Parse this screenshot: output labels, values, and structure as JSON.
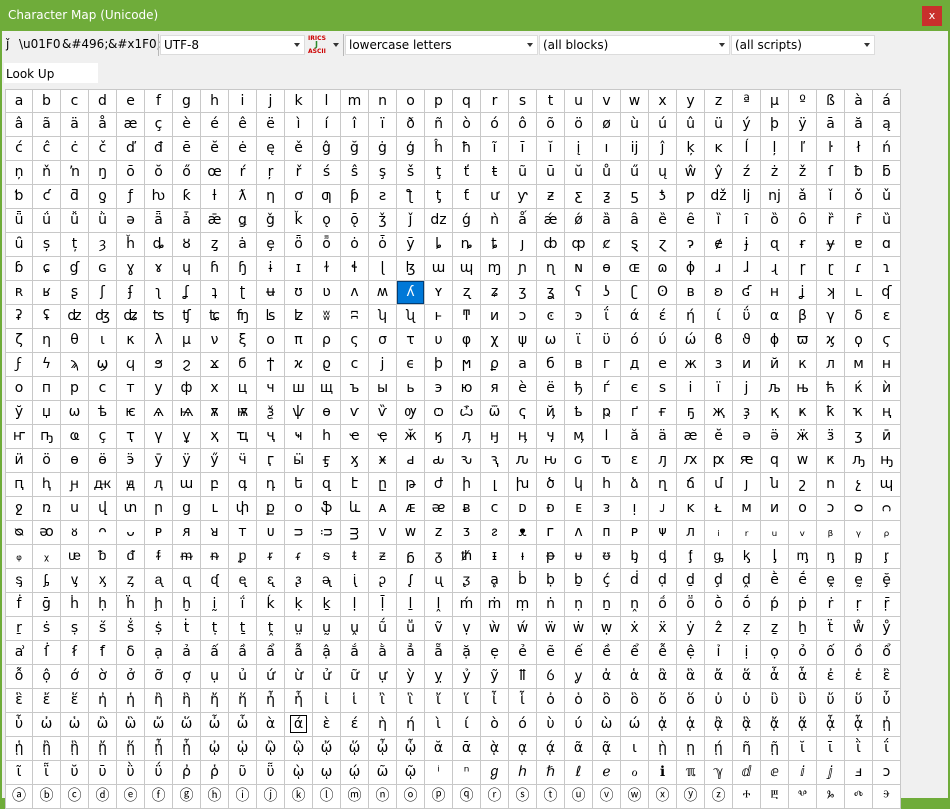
{
  "window": {
    "title": "Character Map (Unicode)",
    "close_label": "x"
  },
  "toolbar": {
    "char_glyph": "ǰ",
    "escape_u": "\\u01F0",
    "entity_dec": "&#496;",
    "entity_hex": "&#x1F0;",
    "encoding": "UTF-8",
    "ascii_top": "IRICS",
    "ascii_mid": "J",
    "ascii_bot": "ASCII",
    "category": "lowercase letters",
    "blocks": "(all blocks)",
    "scripts": "(all scripts)"
  },
  "lookup": {
    "label": "Look Up",
    "value": ""
  },
  "colors": {
    "title_bar": "#6fac3a",
    "selection": "#0078d7",
    "close": "#c9302c"
  },
  "grid": {
    "columns": 32,
    "selected": [
      8,
      14
    ],
    "boxed": [
      26,
      10
    ],
    "rows": [
      [
        "a",
        "b",
        "c",
        "d",
        "e",
        "f",
        "g",
        "h",
        "i",
        "j",
        "k",
        "l",
        "m",
        "n",
        "o",
        "p",
        "q",
        "r",
        "s",
        "t",
        "u",
        "v",
        "w",
        "x",
        "y",
        "z",
        "ª",
        "µ",
        "º",
        "ß",
        "à",
        "á"
      ],
      [
        "â",
        "ã",
        "ä",
        "å",
        "æ",
        "ç",
        "è",
        "é",
        "ê",
        "ë",
        "ì",
        "í",
        "î",
        "ï",
        "ð",
        "ñ",
        "ò",
        "ó",
        "ô",
        "õ",
        "ö",
        "ø",
        "ù",
        "ú",
        "û",
        "ü",
        "ý",
        "þ",
        "ÿ",
        "ā",
        "ă",
        "ą"
      ],
      [
        "ć",
        "ĉ",
        "ċ",
        "č",
        "ď",
        "đ",
        "ē",
        "ĕ",
        "ė",
        "ę",
        "ě",
        "ĝ",
        "ğ",
        "ġ",
        "ģ",
        "ĥ",
        "ħ",
        "ĩ",
        "ī",
        "ĭ",
        "į",
        "ı",
        "ĳ",
        "ĵ",
        "ķ",
        "ĸ",
        "ĺ",
        "ļ",
        "ľ",
        "ŀ",
        "ł",
        "ń"
      ],
      [
        "ņ",
        "ň",
        "ŉ",
        "ŋ",
        "ō",
        "ŏ",
        "ő",
        "œ",
        "ŕ",
        "ŗ",
        "ř",
        "ś",
        "ŝ",
        "ş",
        "š",
        "ţ",
        "ť",
        "ŧ",
        "ũ",
        "ū",
        "ŭ",
        "ů",
        "ű",
        "ų",
        "ŵ",
        "ŷ",
        "ź",
        "ż",
        "ž",
        "ſ",
        "ƀ",
        "ƃ"
      ],
      [
        "ƅ",
        "ƈ",
        "ƌ",
        "ƍ",
        "ƒ",
        "ƕ",
        "ƙ",
        "ƚ",
        "ƛ",
        "ƞ",
        "ơ",
        "ƣ",
        "ƥ",
        "ƨ",
        "ƪ",
        "ƫ",
        "ƭ",
        "ư",
        "ƴ",
        "ƶ",
        "ƹ",
        "ƺ",
        "ƽ",
        "ƾ",
        "ƿ",
        "dž",
        "lj",
        "nj",
        "ǎ",
        "ǐ",
        "ǒ",
        "ǔ"
      ],
      [
        "ǖ",
        "ǘ",
        "ǚ",
        "ǜ",
        "ǝ",
        "ǟ",
        "ǡ",
        "ǣ",
        "ǥ",
        "ǧ",
        "ǩ",
        "ǫ",
        "ǭ",
        "ǯ",
        "ǰ",
        "dz",
        "ǵ",
        "ǹ",
        "ǻ",
        "ǽ",
        "ǿ",
        "ȁ",
        "ȃ",
        "ȅ",
        "ȇ",
        "ȉ",
        "ȋ",
        "ȍ",
        "ȏ",
        "ȑ",
        "ȓ",
        "ȕ"
      ],
      [
        "ȗ",
        "ș",
        "ț",
        "ȝ",
        "ȟ",
        "ȡ",
        "ȣ",
        "ȥ",
        "ȧ",
        "ȩ",
        "ȫ",
        "ȭ",
        "ȯ",
        "ȱ",
        "ȳ",
        "ȴ",
        "ȵ",
        "ȶ",
        "ȷ",
        "ȸ",
        "ȹ",
        "ȼ",
        "ȿ",
        "ɀ",
        "ɂ",
        "ɇ",
        "ɉ",
        "ɋ",
        "ɍ",
        "ɏ",
        "ɐ",
        "ɑ"
      ],
      [
        "ɓ",
        "ɕ",
        "ɠ",
        "ɢ",
        "ɣ",
        "ɤ",
        "ɥ",
        "ɦ",
        "ɧ",
        "ɨ",
        "ɪ",
        "ɫ",
        "ɬ",
        "ɭ",
        "ɮ",
        "ɯ",
        "ɰ",
        "ɱ",
        "ɲ",
        "ɳ",
        "ɴ",
        "ɵ",
        "ɶ",
        "ɷ",
        "ɸ",
        "ɹ",
        "ɺ",
        "ɻ",
        "ɼ",
        "ɽ",
        "ɾ",
        "ɿ"
      ],
      [
        "ʀ",
        "ʁ",
        "ʂ",
        "ʃ",
        "ʄ",
        "ʅ",
        "ʆ",
        "ʇ",
        "ʈ",
        "ʉ",
        "ʊ",
        "ʋ",
        "ʌ",
        "ʍ",
        "ʎ",
        "ʏ",
        "ʐ",
        "ʑ",
        "ʒ",
        "ʓ",
        "ʕ",
        "ʖ",
        "ʗ",
        "ʘ",
        "ʙ",
        "ʚ",
        "ʛ",
        "ʜ",
        "ʝ",
        "ʞ",
        "ʟ",
        "ʠ"
      ],
      [
        "ʡ",
        "ʢ",
        "ʣ",
        "ʤ",
        "ʥ",
        "ʦ",
        "ʧ",
        "ʨ",
        "ʩ",
        "ʪ",
        "ʫ",
        "ʬ",
        "ʭ",
        "ʮ",
        "ʯ",
        "ͱ",
        "ͳ",
        "ͷ",
        "ͻ",
        "ͼ",
        "ͽ",
        "ΐ",
        "ά",
        "έ",
        "ή",
        "ί",
        "ΰ",
        "α",
        "β",
        "γ",
        "δ",
        "ε"
      ],
      [
        "ζ",
        "η",
        "θ",
        "ι",
        "κ",
        "λ",
        "μ",
        "ν",
        "ξ",
        "ο",
        "π",
        "ρ",
        "ς",
        "σ",
        "τ",
        "υ",
        "φ",
        "χ",
        "ψ",
        "ω",
        "ϊ",
        "ϋ",
        "ό",
        "ύ",
        "ώ",
        "ϐ",
        "ϑ",
        "ϕ",
        "ϖ",
        "ϗ",
        "ϙ",
        "ϛ"
      ],
      [
        "ϝ",
        "ϟ",
        "ϡ",
        "ϣ",
        "ϥ",
        "ϧ",
        "ϩ",
        "ϫ",
        "ϭ",
        "ϯ",
        "ϰ",
        "ϱ",
        "ϲ",
        "ϳ",
        "ϵ",
        "ϸ",
        "ϻ",
        "ϼ",
        "а",
        "б",
        "в",
        "г",
        "д",
        "е",
        "ж",
        "з",
        "и",
        "й",
        "к",
        "л",
        "м",
        "н"
      ],
      [
        "о",
        "п",
        "р",
        "с",
        "т",
        "у",
        "ф",
        "х",
        "ц",
        "ч",
        "ш",
        "щ",
        "ъ",
        "ы",
        "ь",
        "э",
        "ю",
        "я",
        "ѐ",
        "ё",
        "ђ",
        "ѓ",
        "є",
        "ѕ",
        "і",
        "ї",
        "ј",
        "љ",
        "њ",
        "ћ",
        "ќ",
        "ѝ"
      ],
      [
        "ў",
        "џ",
        "ѡ",
        "ѣ",
        "ѥ",
        "ѧ",
        "ѩ",
        "ѫ",
        "ѭ",
        "ѯ",
        "ѱ",
        "ѳ",
        "ѵ",
        "ѷ",
        "ѹ",
        "ѻ",
        "ѽ",
        "ѿ",
        "ҁ",
        "ҋ",
        "ҍ",
        "ҏ",
        "ґ",
        "ғ",
        "ҕ",
        "җ",
        "ҙ",
        "қ",
        "ҝ",
        "ҟ",
        "ҡ",
        "ң"
      ],
      [
        "ҥ",
        "ҧ",
        "ҩ",
        "ҫ",
        "ҭ",
        "ү",
        "ұ",
        "ҳ",
        "ҵ",
        "ҷ",
        "ҹ",
        "һ",
        "ҽ",
        "ҿ",
        "ӂ",
        "ӄ",
        "ӆ",
        "ӈ",
        "ӊ",
        "ӌ",
        "ӎ",
        "ӏ",
        "ӑ",
        "ӓ",
        "ӕ",
        "ӗ",
        "ә",
        "ӛ",
        "ӝ",
        "ӟ",
        "ӡ",
        "ӣ"
      ],
      [
        "ӥ",
        "ӧ",
        "ө",
        "ӫ",
        "ӭ",
        "ӯ",
        "ӱ",
        "ӳ",
        "ӵ",
        "ӷ",
        "ӹ",
        "ӻ",
        "ӽ",
        "ӿ",
        "ԁ",
        "ԃ",
        "ԅ",
        "ԇ",
        "ԉ",
        "ԋ",
        "ԍ",
        "ԏ",
        "ԑ",
        "ԓ",
        "ԕ",
        "ԗ",
        "ԙ",
        "ԛ",
        "ԝ",
        "ԟ",
        "ԡ",
        "ԣ"
      ],
      [
        "ԥ",
        "ԧ",
        "ԩ",
        "ԫ",
        "ԭ",
        "ԯ",
        "ա",
        "բ",
        "գ",
        "դ",
        "ե",
        "զ",
        "է",
        "ը",
        "թ",
        "ժ",
        "ի",
        "լ",
        "խ",
        "ծ",
        "կ",
        "հ",
        "ձ",
        "ղ",
        "ճ",
        "մ",
        "յ",
        "ն",
        "շ",
        "ո",
        "չ",
        "պ"
      ],
      [
        "ջ",
        "ռ",
        "ս",
        "վ",
        "տ",
        "ր",
        "ց",
        "ւ",
        "փ",
        "ք",
        "օ",
        "ֆ",
        "և",
        "ᴀ",
        "ᴁ",
        "ᴂ",
        "ᴃ",
        "ᴄ",
        "ᴅ",
        "ᴆ",
        "ᴇ",
        "ᴈ",
        "ᴉ",
        "ᴊ",
        "ᴋ",
        "ᴌ",
        "ᴍ",
        "ᴎ",
        "ᴏ",
        "ᴐ",
        "ᴑ",
        "ᴒ"
      ],
      [
        "ᴓ",
        "ᴔ",
        "ᴕ",
        "ᴖ",
        "ᴗ",
        "ᴘ",
        "ᴙ",
        "ᴚ",
        "ᴛ",
        "ᴜ",
        "ᴝ",
        "ᴞ",
        "ᴟ",
        "ᴠ",
        "ᴡ",
        "ᴢ",
        "ᴣ",
        "ᴤ",
        "ᴥ",
        "ᴦ",
        "ᴧ",
        "ᴨ",
        "ᴩ",
        "ᴪ",
        "ᴫ",
        "ᵢ",
        "ᵣ",
        "ᵤ",
        "ᵥ",
        "ᵦ",
        "ᵧ",
        "ᵨ"
      ],
      [
        "ᵩ",
        "ᵪ",
        "ᵫ",
        "ᵬ",
        "ᵭ",
        "ᵮ",
        "ᵯ",
        "ᵰ",
        "ᵱ",
        "ᵲ",
        "ᵳ",
        "ᵴ",
        "ᵵ",
        "ᵶ",
        "ᵷ",
        "ᵹ",
        "ᵺ",
        "ᵻ",
        "ᵼ",
        "ᵽ",
        "ᵾ",
        "ᵿ",
        "ᶀ",
        "ᶁ",
        "ᶂ",
        "ᶃ",
        "ᶄ",
        "ᶅ",
        "ᶆ",
        "ᶇ",
        "ᶈ",
        "ᶉ"
      ],
      [
        "ᶊ",
        "ᶋ",
        "ᶌ",
        "ᶍ",
        "ᶎ",
        "ᶏ",
        "ᶐ",
        "ᶑ",
        "ᶒ",
        "ᶓ",
        "ᶔ",
        "ᶕ",
        "ᶖ",
        "ᶗ",
        "ᶘ",
        "ᶙ",
        "ᶚ",
        "ḁ",
        "ḃ",
        "ḅ",
        "ḇ",
        "ḉ",
        "ḋ",
        "ḍ",
        "ḏ",
        "ḑ",
        "ḓ",
        "ḕ",
        "ḗ",
        "ḙ",
        "ḛ",
        "ḝ"
      ],
      [
        "ḟ",
        "ḡ",
        "ḣ",
        "ḥ",
        "ḧ",
        "ḩ",
        "ḫ",
        "ḭ",
        "ḯ",
        "ḱ",
        "ḳ",
        "ḵ",
        "ḷ",
        "ḹ",
        "ḻ",
        "ḽ",
        "ḿ",
        "ṁ",
        "ṃ",
        "ṅ",
        "ṇ",
        "ṉ",
        "ṋ",
        "ṍ",
        "ṏ",
        "ṑ",
        "ṓ",
        "ṕ",
        "ṗ",
        "ṙ",
        "ṛ",
        "ṝ"
      ],
      [
        "ṟ",
        "ṡ",
        "ṣ",
        "ṥ",
        "ṧ",
        "ṩ",
        "ṫ",
        "ṭ",
        "ṯ",
        "ṱ",
        "ṳ",
        "ṵ",
        "ṷ",
        "ṹ",
        "ṻ",
        "ṽ",
        "ṿ",
        "ẁ",
        "ẃ",
        "ẅ",
        "ẇ",
        "ẉ",
        "ẋ",
        "ẍ",
        "ẏ",
        "ẑ",
        "ẓ",
        "ẕ",
        "ẖ",
        "ẗ",
        "ẘ",
        "ẙ"
      ],
      [
        "ẚ",
        "ẛ",
        "ẜ",
        "ẝ",
        "ẟ",
        "ạ",
        "ả",
        "ấ",
        "ầ",
        "ẩ",
        "ẫ",
        "ậ",
        "ắ",
        "ằ",
        "ẳ",
        "ẵ",
        "ặ",
        "ẹ",
        "ẻ",
        "ẽ",
        "ế",
        "ề",
        "ể",
        "ễ",
        "ệ",
        "ỉ",
        "ị",
        "ọ",
        "ỏ",
        "ố",
        "ồ",
        "ổ"
      ],
      [
        "ỗ",
        "ộ",
        "ớ",
        "ờ",
        "ở",
        "ỡ",
        "ợ",
        "ụ",
        "ủ",
        "ứ",
        "ừ",
        "ử",
        "ữ",
        "ự",
        "ỳ",
        "ỵ",
        "ỷ",
        "ỹ",
        "ỻ",
        "ỽ",
        "ỿ",
        "ἀ",
        "ἁ",
        "ἂ",
        "ἃ",
        "ἄ",
        "ἅ",
        "ἆ",
        "ἇ",
        "ἐ",
        "ἑ",
        "ἒ"
      ],
      [
        "ἓ",
        "ἔ",
        "ἕ",
        "ἠ",
        "ἡ",
        "ἢ",
        "ἣ",
        "ἤ",
        "ἥ",
        "ἦ",
        "ἧ",
        "ἰ",
        "ἱ",
        "ἲ",
        "ἳ",
        "ἴ",
        "ἵ",
        "ἶ",
        "ἷ",
        "ὀ",
        "ὁ",
        "ὂ",
        "ὃ",
        "ὄ",
        "ὅ",
        "ὐ",
        "ὑ",
        "ὒ",
        "ὓ",
        "ὔ",
        "ὕ",
        "ὖ"
      ],
      [
        "ὗ",
        "ὠ",
        "ὡ",
        "ὢ",
        "ὣ",
        "ὤ",
        "ὥ",
        "ὦ",
        "ὧ",
        "ὰ",
        "ά",
        "ὲ",
        "έ",
        "ὴ",
        "ή",
        "ὶ",
        "ί",
        "ὸ",
        "ό",
        "ὺ",
        "ύ",
        "ὼ",
        "ώ",
        "ᾀ",
        "ᾁ",
        "ᾂ",
        "ᾃ",
        "ᾄ",
        "ᾅ",
        "ᾆ",
        "ᾇ",
        "ᾐ"
      ],
      [
        "ᾑ",
        "ᾒ",
        "ᾓ",
        "ᾔ",
        "ᾕ",
        "ᾖ",
        "ᾗ",
        "ᾠ",
        "ᾡ",
        "ᾢ",
        "ᾣ",
        "ᾤ",
        "ᾥ",
        "ᾦ",
        "ᾧ",
        "ᾰ",
        "ᾱ",
        "ᾲ",
        "ᾳ",
        "ᾴ",
        "ᾶ",
        "ᾷ",
        "ι",
        "ῂ",
        "ῃ",
        "ῄ",
        "ῆ",
        "ῇ",
        "ῐ",
        "ῑ",
        "ῒ",
        "ΐ"
      ],
      [
        "ῖ",
        "ῗ",
        "ῠ",
        "ῡ",
        "ῢ",
        "ΰ",
        "ῤ",
        "ῥ",
        "ῦ",
        "ῧ",
        "ῲ",
        "ῳ",
        "ῴ",
        "ῶ",
        "ῷ",
        "ⁱ",
        "ⁿ",
        "ℊ",
        "ℎ",
        "ℏ",
        "ℓ",
        "ℯ",
        "ℴ",
        "ℹ",
        "ℼ",
        "ℽ",
        "ⅆ",
        "ⅇ",
        "ⅈ",
        "ⅉ",
        "ⅎ",
        "ↄ"
      ],
      [
        "ⓐ",
        "ⓑ",
        "ⓒ",
        "ⓓ",
        "ⓔ",
        "ⓕ",
        "ⓖ",
        "ⓗ",
        "ⓘ",
        "ⓙ",
        "ⓚ",
        "ⓛ",
        "ⓜ",
        "ⓝ",
        "ⓞ",
        "ⓟ",
        "ⓠ",
        "ⓡ",
        "ⓢ",
        "ⓣ",
        "ⓤ",
        "ⓥ",
        "ⓦ",
        "ⓧ",
        "ⓨ",
        "ⓩ",
        "ⰰ",
        "ⰱ",
        "ⰲ",
        "ⰳ",
        "ⰴ",
        "ⰵ"
      ]
    ]
  }
}
